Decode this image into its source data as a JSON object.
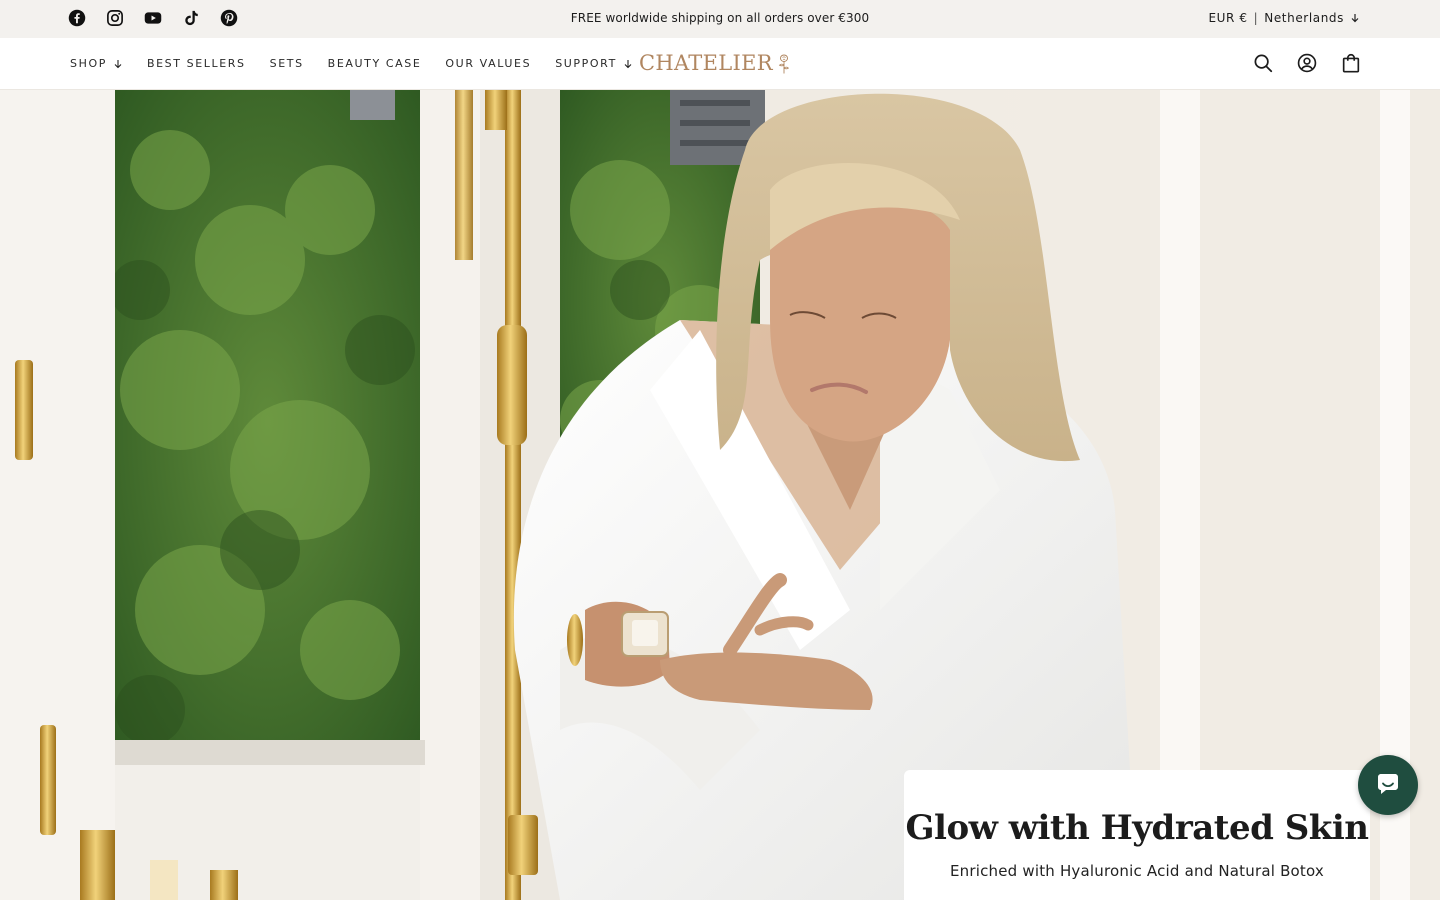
{
  "announcement": {
    "text": "FREE worldwide shipping on all orders over €300",
    "socials": [
      "facebook-icon",
      "instagram-icon",
      "youtube-icon",
      "tiktok-icon",
      "pinterest-icon"
    ],
    "locale": {
      "currency": "EUR €",
      "separator": "|",
      "country": "Netherlands"
    }
  },
  "header": {
    "nav": [
      {
        "label": "SHOP",
        "has_dropdown": true
      },
      {
        "label": "BEST SELLERS",
        "has_dropdown": false
      },
      {
        "label": "SETS",
        "has_dropdown": false
      },
      {
        "label": "BEAUTY CASE",
        "has_dropdown": false
      },
      {
        "label": "OUR VALUES",
        "has_dropdown": false
      },
      {
        "label": "SUPPORT",
        "has_dropdown": true
      }
    ],
    "logo": "CHATELIER",
    "icons": [
      "search-icon",
      "account-icon",
      "bag-icon"
    ]
  },
  "hero": {
    "title": "Glow with Hydrated Skin",
    "subtitle": "Enriched with Hyaluronic Acid and Natural Botox"
  },
  "colors": {
    "announcement_bg": "#f3f1ee",
    "brand": "#b08660",
    "chat": "#1f4d3f"
  }
}
